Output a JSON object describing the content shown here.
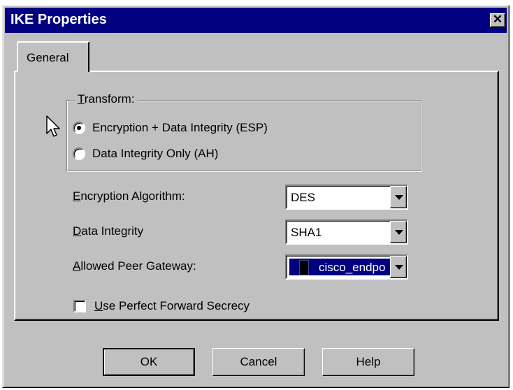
{
  "window": {
    "title": "IKE Properties",
    "close_glyph": "✕"
  },
  "tabs": [
    {
      "label": "General",
      "active": true
    }
  ],
  "transform": {
    "label_accel": "T",
    "label_rest": "ransform:",
    "options": [
      {
        "label": "Encryption + Data Integrity (ESP)",
        "selected": true
      },
      {
        "label": "Data Integrity Only (AH)",
        "selected": false
      }
    ]
  },
  "fields": {
    "encryption_algorithm": {
      "label_accel": "E",
      "label_rest": "ncryption Algorithm:",
      "value": "DES"
    },
    "data_integrity": {
      "label_accel": "D",
      "label_rest": "ata Integrity",
      "value": "SHA1"
    },
    "allowed_peer_gateway": {
      "label_accel": "A",
      "label_rest": "llowed Peer Gateway:",
      "value": "cisco_endpo"
    }
  },
  "pfs": {
    "label_accel": "U",
    "label_rest": "se Perfect Forward Secrecy",
    "checked": false
  },
  "buttons": {
    "ok": "OK",
    "cancel": "Cancel",
    "help": "Help"
  },
  "colors": {
    "titlebar": "#000080",
    "face": "#c0c0c0",
    "selection": "#000080"
  }
}
